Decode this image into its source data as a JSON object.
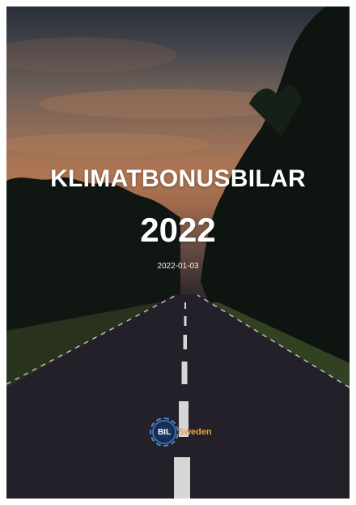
{
  "cover": {
    "title": "KLIMATBONUSBILAR",
    "year": "2022",
    "date": "2022-01-03",
    "logo": {
      "mark_text": "BIL",
      "wordmark": "Sweden",
      "mark_color": "#3b6fb3",
      "wordmark_color": "#e8a247"
    }
  },
  "colors": {
    "sky_top": "#2f3540",
    "sunset": "#c8875e",
    "trees": "#141a16",
    "road": "#2a2530",
    "lane_marking": "#ffffff"
  }
}
